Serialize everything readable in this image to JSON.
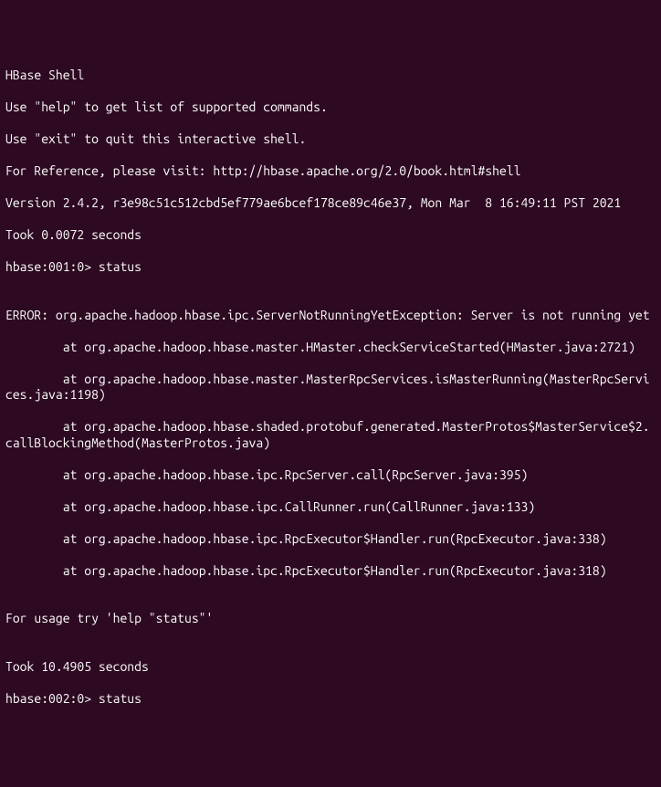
{
  "header": {
    "title": "HBase Shell",
    "help_line": "Use \"help\" to get list of supported commands.",
    "exit_line": "Use \"exit\" to quit this interactive shell.",
    "reference_line": "For Reference, please visit: http://hbase.apache.org/2.0/book.html#shell",
    "version_line": "Version 2.4.2, r3e98c51c512cbd5ef779ae6bcef178ce89c46e37, Mon Mar  8 16:49:11 PST 2021",
    "took_line": "Took 0.0072 seconds"
  },
  "session": {
    "prompt1": "hbase:001:0>",
    "command1": " status",
    "blank1": "",
    "error_head": "ERROR: org.apache.hadoop.hbase.ipc.ServerNotRunningYetException: Server is not running yet",
    "trace1": "        at org.apache.hadoop.hbase.master.HMaster.checkServiceStarted(HMaster.java:2721)",
    "trace2": "        at org.apache.hadoop.hbase.master.MasterRpcServices.isMasterRunning(MasterRpcServices.java:1198)",
    "trace3": "        at org.apache.hadoop.hbase.shaded.protobuf.generated.MasterProtos$MasterService$2.callBlockingMethod(MasterProtos.java)",
    "trace4": "        at org.apache.hadoop.hbase.ipc.RpcServer.call(RpcServer.java:395)",
    "trace5": "        at org.apache.hadoop.hbase.ipc.CallRunner.run(CallRunner.java:133)",
    "trace6": "        at org.apache.hadoop.hbase.ipc.RpcExecutor$Handler.run(RpcExecutor.java:338)",
    "trace7": "        at org.apache.hadoop.hbase.ipc.RpcExecutor$Handler.run(RpcExecutor.java:318)",
    "blank2": "",
    "usage_line": "For usage try 'help \"status\"'",
    "blank3": "",
    "took_line2": "Took 10.4905 seconds",
    "prompt2": "hbase:002:0>",
    "command2": " status"
  }
}
